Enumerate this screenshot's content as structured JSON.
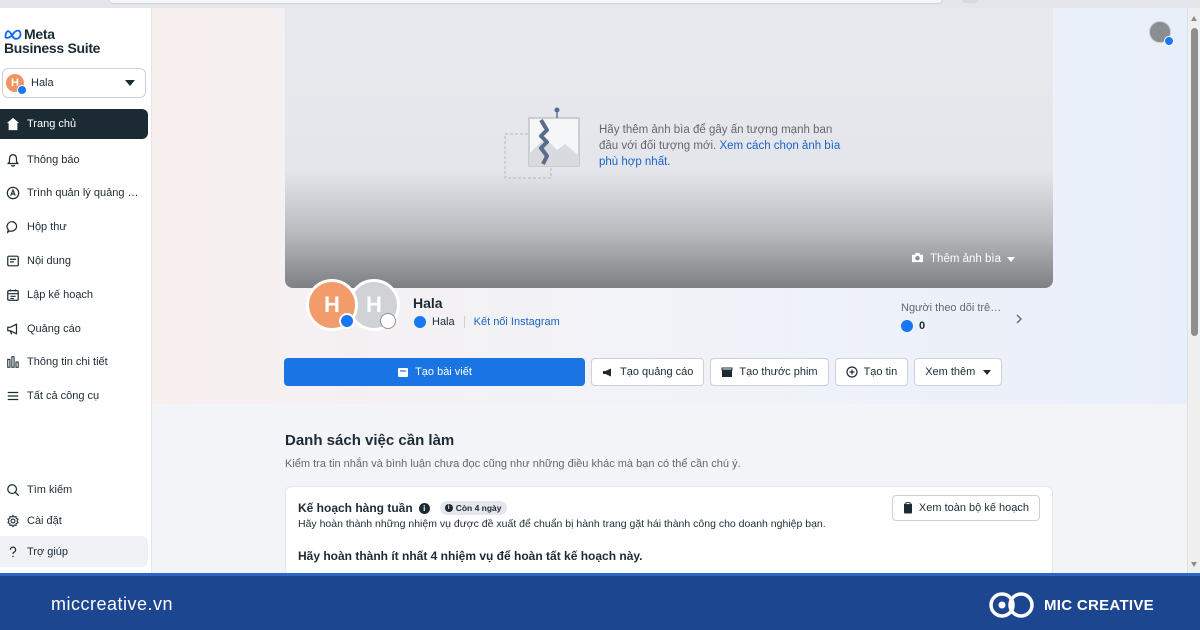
{
  "brand": {
    "line1": "Meta",
    "line2": "Business Suite",
    "accent": "#0866ff"
  },
  "account": {
    "initial": "H",
    "name": "Hala"
  },
  "nav": [
    {
      "label": "Trang chủ",
      "icon": "home-icon",
      "active": true
    },
    {
      "label": "Thông báo",
      "icon": "bell-icon"
    },
    {
      "label": "Trình quản lý quảng cáo",
      "icon": "ads-manager-icon"
    },
    {
      "label": "Hộp thư",
      "icon": "chat-bubble-icon"
    },
    {
      "label": "Nội dung",
      "icon": "content-icon"
    },
    {
      "label": "Lập kế hoạch",
      "icon": "calendar-icon"
    },
    {
      "label": "Quảng cáo",
      "icon": "megaphone-icon"
    },
    {
      "label": "Thông tin chi tiết",
      "icon": "bar-chart-icon"
    },
    {
      "label": "Tất cả công cụ",
      "icon": "menu-icon"
    }
  ],
  "bottom_nav": [
    {
      "label": "Tìm kiếm",
      "icon": "search-icon"
    },
    {
      "label": "Cài đặt",
      "icon": "gear-icon"
    },
    {
      "label": "Trợ giúp",
      "icon": "help-icon"
    }
  ],
  "cover": {
    "message": "Hãy thêm ảnh bìa để gây ấn tượng mạnh ban đầu với đối tượng mới.",
    "link": "Xem cách chọn ảnh bìa phù hợp nhất.",
    "add_label": "Thêm ảnh bìa"
  },
  "profile": {
    "fb_initial": "H",
    "ig_initial": "H",
    "name": "Hala",
    "fb_name": "Hala",
    "connect_instagram": "Kết nối Instagram",
    "followers_label": "Người theo dõi trên Facebook",
    "followers_count": "0"
  },
  "actions": {
    "create_post": "Tạo bài viết",
    "create_ad": "Tạo quảng cáo",
    "create_reel": "Tạo thước phim",
    "create_story": "Tạo tin",
    "see_more": "Xem thêm"
  },
  "todo": {
    "title": "Danh sách việc cần làm",
    "subtitle": "Kiểm tra tin nhắn và bình luận chưa đọc cũng như những điều khác mà bạn có thể cần chú ý.",
    "card": {
      "title": "Kế hoạch hàng tuần",
      "chip": "Còn 4 ngày",
      "description": "Hãy hoàn thành những nhiệm vụ được đề xuất để chuẩn bị hành trang gặt hái thành công cho doanh nghiệp bạn.",
      "goal": "Hãy hoàn thành ít nhất 4 nhiệm vụ để hoàn tất kế hoạch này.",
      "view_all": "Xem toàn bộ kế hoạch"
    }
  },
  "footer": {
    "site": "miccreative.vn",
    "brand": "MIC CREATIVE",
    "bg": "#1d4690"
  }
}
